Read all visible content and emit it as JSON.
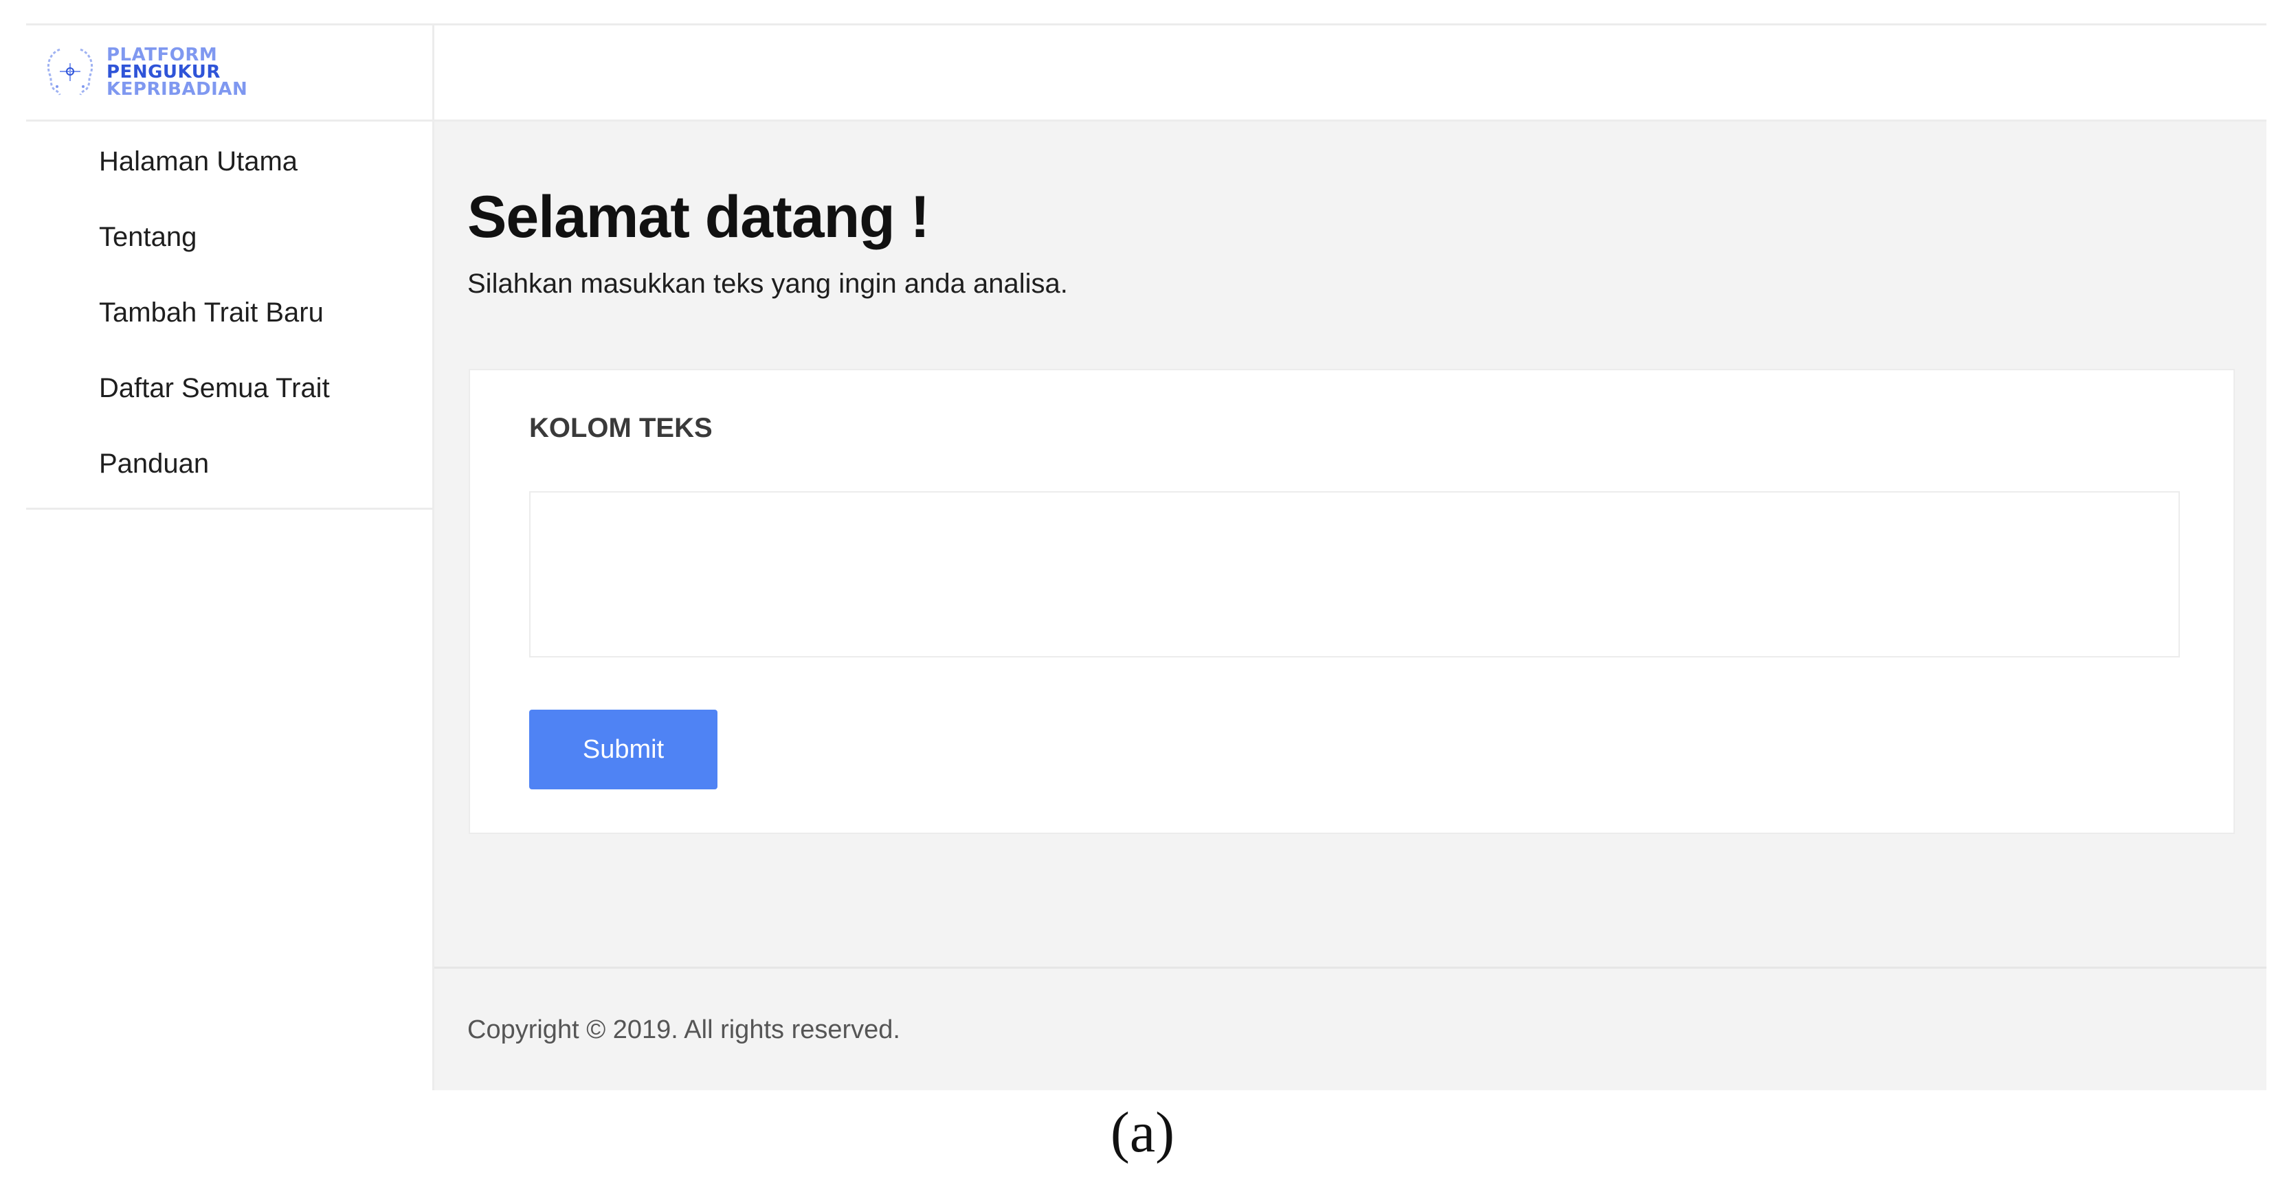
{
  "brand": {
    "logo_line_1": "PLATFORM",
    "logo_line_2": "PENGUKUR",
    "logo_line_3": "KEPRIBADIAN",
    "colors": {
      "light": "#7f98f0",
      "dark": "#2f54d8"
    }
  },
  "sidebar": {
    "items": [
      {
        "label": "Halaman Utama"
      },
      {
        "label": "Tentang"
      },
      {
        "label": "Tambah Trait Baru"
      },
      {
        "label": "Daftar Semua Trait"
      },
      {
        "label": "Panduan"
      }
    ]
  },
  "main": {
    "title": "Selamat datang !",
    "subtitle": "Silahkan masukkan teks yang ingin anda analisa.",
    "card": {
      "label": "KOLOM TEKS",
      "textarea_value": "",
      "submit_label": "Submit"
    }
  },
  "footer": {
    "copyright": "Copyright © 2019. All rights reserved."
  },
  "caption": "(a)",
  "colors": {
    "accent": "#4f83f4",
    "content_bg": "#f3f3f3"
  }
}
